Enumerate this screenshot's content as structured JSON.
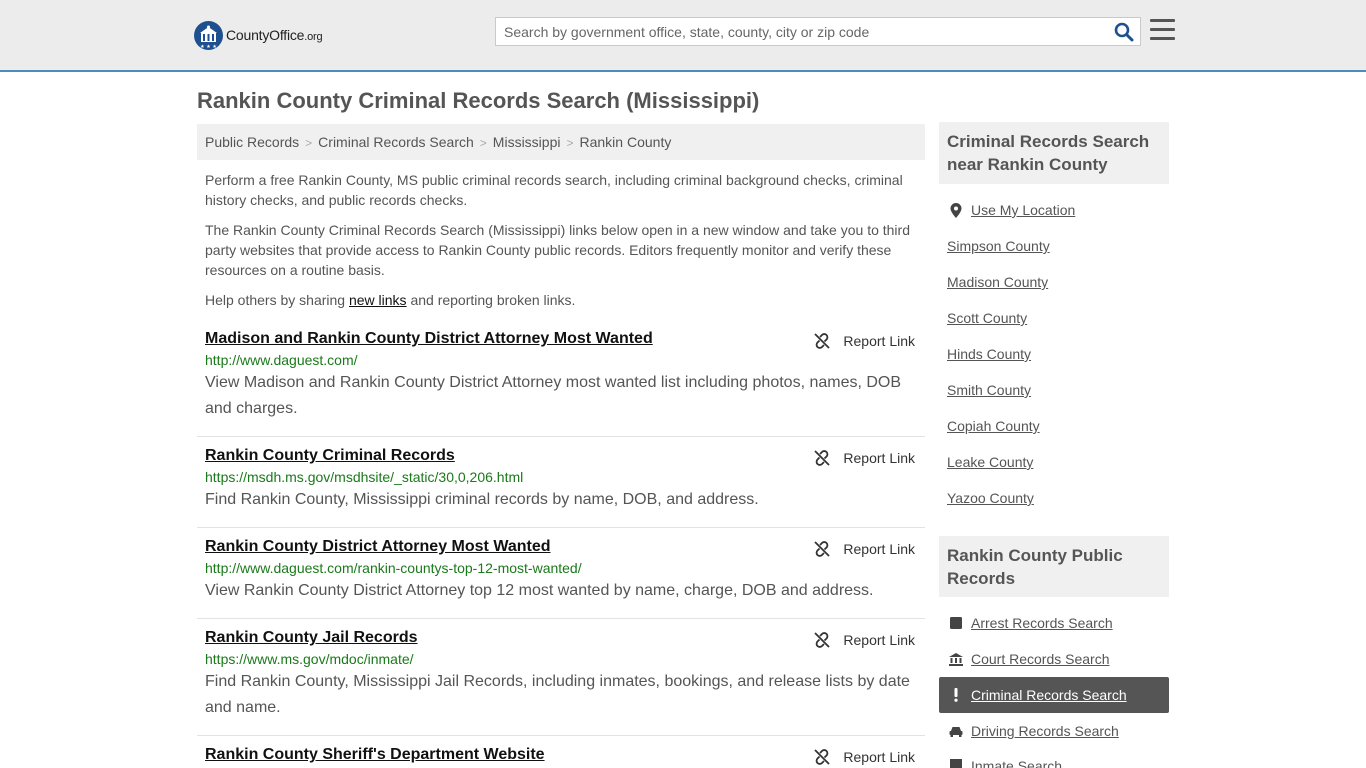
{
  "header": {
    "logo_text": "CountyOffice",
    "logo_suffix": ".org",
    "search_placeholder": "Search by government office, state, county, city or zip code"
  },
  "page_title": "Rankin County Criminal Records Search (Mississippi)",
  "breadcrumb": [
    "Public Records",
    "Criminal Records Search",
    "Mississippi",
    "Rankin County"
  ],
  "intro": {
    "p1": "Perform a free Rankin County, MS public criminal records search, including criminal background checks, criminal history checks, and public records checks.",
    "p2": "The Rankin County Criminal Records Search (Mississippi) links below open in a new window and take you to third party websites that provide access to Rankin County public records. Editors frequently monitor and verify these resources on a routine basis.",
    "p3_before": "Help others by sharing ",
    "p3_link": "new links",
    "p3_after": " and reporting broken links."
  },
  "report_label": "Report Link",
  "records": [
    {
      "title": "Madison and Rankin County District Attorney Most Wanted",
      "url": "http://www.daguest.com/",
      "desc": "View Madison and Rankin County District Attorney most wanted list including photos, names, DOB and charges."
    },
    {
      "title": "Rankin County Criminal Records",
      "url": "https://msdh.ms.gov/msdhsite/_static/30,0,206.html",
      "desc": "Find Rankin County, Mississippi criminal records by name, DOB, and address."
    },
    {
      "title": "Rankin County District Attorney Most Wanted",
      "url": "http://www.daguest.com/rankin-countys-top-12-most-wanted/",
      "desc": "View Rankin County District Attorney top 12 most wanted by name, charge, DOB and address."
    },
    {
      "title": "Rankin County Jail Records",
      "url": "https://www.ms.gov/mdoc/inmate/",
      "desc": "Find Rankin County, Mississippi Jail Records, including inmates, bookings, and release lists by date and name."
    },
    {
      "title": "Rankin County Sheriff's Department Website",
      "url": "",
      "desc": ""
    }
  ],
  "sidebar": {
    "nearby_heading": "Criminal Records Search near Rankin County",
    "use_location": "Use My Location",
    "nearby": [
      "Simpson County",
      "Madison County",
      "Scott County",
      "Hinds County",
      "Smith County",
      "Copiah County",
      "Leake County",
      "Yazoo County"
    ],
    "public_heading": "Rankin County Public Records",
    "public_links": [
      {
        "label": "Arrest Records Search",
        "icon": "square-icon"
      },
      {
        "label": "Court Records Search",
        "icon": "courthouse-icon"
      },
      {
        "label": "Criminal Records Search",
        "icon": "exclamation-icon",
        "active": true
      },
      {
        "label": "Driving Records Search",
        "icon": "car-icon"
      },
      {
        "label": "Inmate Search",
        "icon": "inmate-icon"
      }
    ]
  }
}
